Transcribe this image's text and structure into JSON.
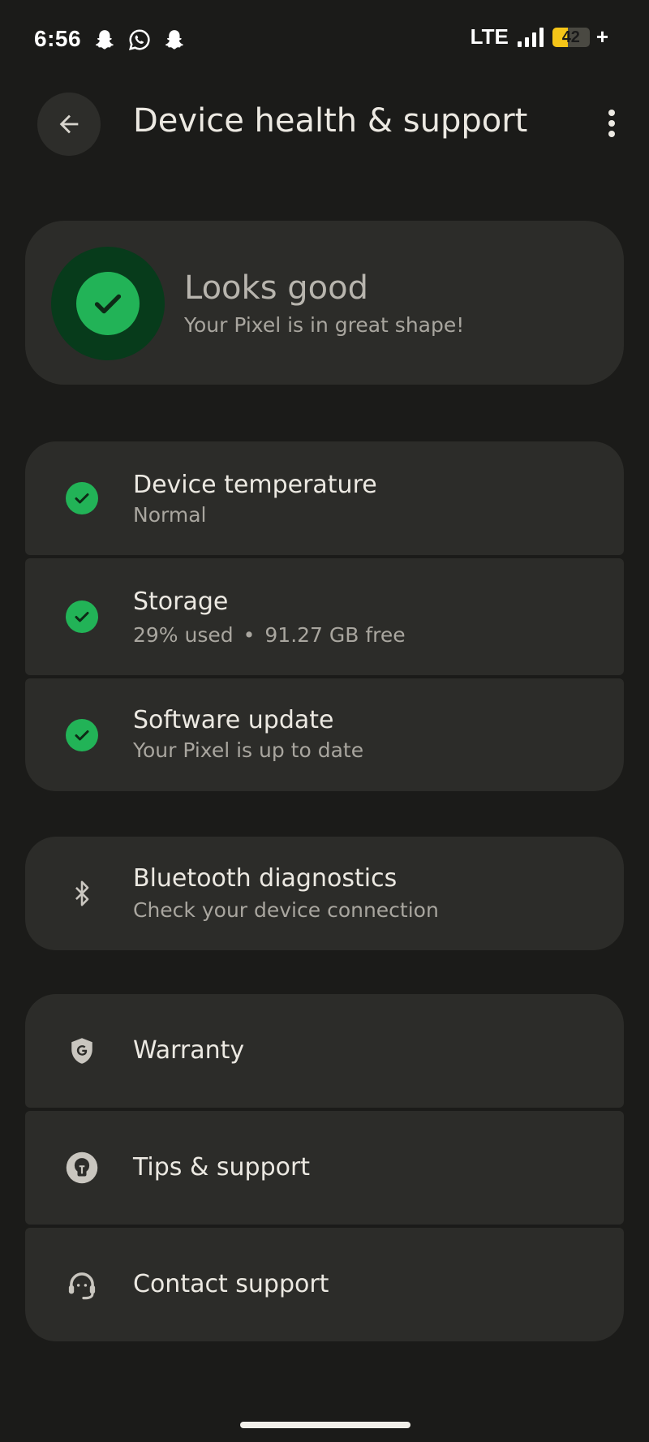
{
  "status_bar": {
    "time": "6:56",
    "notifications": [
      "snapchat-icon",
      "whatsapp-icon",
      "snapchat-icon"
    ],
    "network": "LTE",
    "battery_level": "42",
    "battery_fraction": 0.42,
    "battery_suffix": "+"
  },
  "app_bar": {
    "title": "Device health & support",
    "back_icon": "arrow-back-icon",
    "menu_icon": "more-vert-icon"
  },
  "summary": {
    "title": "Looks good",
    "subtitle": "Your Pixel is in great shape!",
    "icon": "check-circle-icon"
  },
  "health_items": [
    {
      "title": "Device temperature",
      "subtitle": "Normal",
      "icon": "check-circle-icon"
    },
    {
      "title": "Storage",
      "subtitle_parts": [
        "29% used",
        "•",
        "91.27 GB free"
      ],
      "icon": "check-circle-icon"
    },
    {
      "title": "Software update",
      "subtitle": "Your Pixel is up to date",
      "icon": "check-circle-icon"
    }
  ],
  "diagnostics": {
    "title": "Bluetooth diagnostics",
    "subtitle": "Check your device connection",
    "icon": "bluetooth-icon"
  },
  "support_items": [
    {
      "title": "Warranty",
      "icon": "google-shield-icon"
    },
    {
      "title": "Tips & support",
      "icon": "lightbulb-icon"
    },
    {
      "title": "Contact support",
      "icon": "headset-icon"
    }
  ],
  "colors": {
    "background": "#1b1b19",
    "card": "#2c2c29",
    "success": "#22b357",
    "success_dark": "#073b1b",
    "battery": "#f5c518"
  }
}
